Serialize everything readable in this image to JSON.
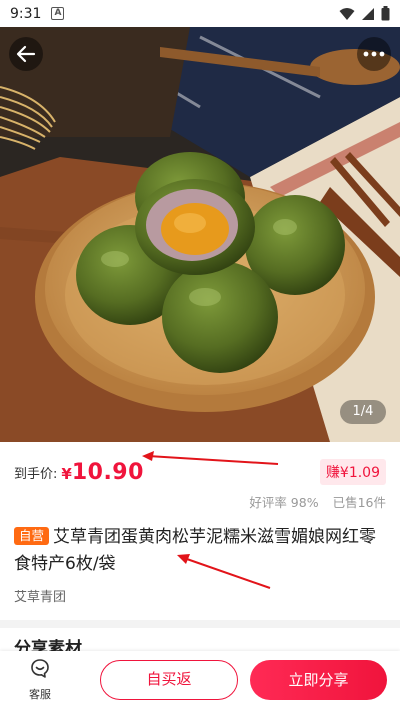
{
  "status_bar": {
    "time": "9:31",
    "badge": "A"
  },
  "hero": {
    "page_indicator": "1/4"
  },
  "product": {
    "price_label": "到手价:",
    "currency": "¥",
    "price": "10.90",
    "earn_badge": "赚¥1.09",
    "rating": "好评率 98%",
    "sold": "已售16件",
    "self_tag": "自营",
    "title": "艾草青团蛋黄肉松芋泥糯米滋雪媚娘网红零食特产6枚/袋",
    "brand": "艾草青团"
  },
  "section": {
    "share_title": "分享素材"
  },
  "bottom_bar": {
    "service_label": "客服",
    "buy_label": "自买返",
    "share_label": "立即分享"
  },
  "colors": {
    "accent": "#f0143c",
    "self_tag": "#ff6a12"
  }
}
